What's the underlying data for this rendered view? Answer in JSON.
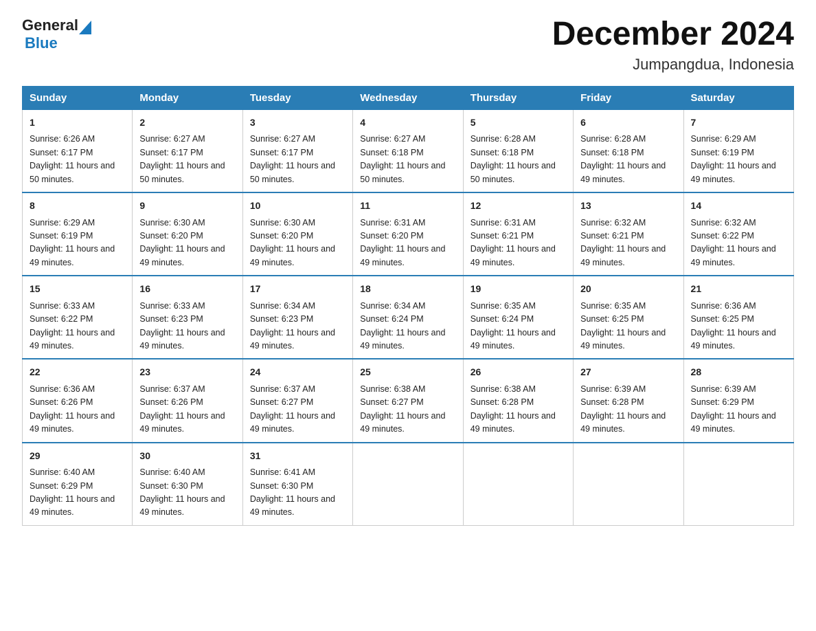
{
  "header": {
    "logo_general": "General",
    "logo_blue": "Blue",
    "title": "December 2024",
    "subtitle": "Jumpangdua, Indonesia"
  },
  "days_of_week": [
    "Sunday",
    "Monday",
    "Tuesday",
    "Wednesday",
    "Thursday",
    "Friday",
    "Saturday"
  ],
  "weeks": [
    [
      {
        "day": "1",
        "sunrise": "Sunrise: 6:26 AM",
        "sunset": "Sunset: 6:17 PM",
        "daylight": "Daylight: 11 hours and 50 minutes."
      },
      {
        "day": "2",
        "sunrise": "Sunrise: 6:27 AM",
        "sunset": "Sunset: 6:17 PM",
        "daylight": "Daylight: 11 hours and 50 minutes."
      },
      {
        "day": "3",
        "sunrise": "Sunrise: 6:27 AM",
        "sunset": "Sunset: 6:17 PM",
        "daylight": "Daylight: 11 hours and 50 minutes."
      },
      {
        "day": "4",
        "sunrise": "Sunrise: 6:27 AM",
        "sunset": "Sunset: 6:18 PM",
        "daylight": "Daylight: 11 hours and 50 minutes."
      },
      {
        "day": "5",
        "sunrise": "Sunrise: 6:28 AM",
        "sunset": "Sunset: 6:18 PM",
        "daylight": "Daylight: 11 hours and 50 minutes."
      },
      {
        "day": "6",
        "sunrise": "Sunrise: 6:28 AM",
        "sunset": "Sunset: 6:18 PM",
        "daylight": "Daylight: 11 hours and 49 minutes."
      },
      {
        "day": "7",
        "sunrise": "Sunrise: 6:29 AM",
        "sunset": "Sunset: 6:19 PM",
        "daylight": "Daylight: 11 hours and 49 minutes."
      }
    ],
    [
      {
        "day": "8",
        "sunrise": "Sunrise: 6:29 AM",
        "sunset": "Sunset: 6:19 PM",
        "daylight": "Daylight: 11 hours and 49 minutes."
      },
      {
        "day": "9",
        "sunrise": "Sunrise: 6:30 AM",
        "sunset": "Sunset: 6:20 PM",
        "daylight": "Daylight: 11 hours and 49 minutes."
      },
      {
        "day": "10",
        "sunrise": "Sunrise: 6:30 AM",
        "sunset": "Sunset: 6:20 PM",
        "daylight": "Daylight: 11 hours and 49 minutes."
      },
      {
        "day": "11",
        "sunrise": "Sunrise: 6:31 AM",
        "sunset": "Sunset: 6:20 PM",
        "daylight": "Daylight: 11 hours and 49 minutes."
      },
      {
        "day": "12",
        "sunrise": "Sunrise: 6:31 AM",
        "sunset": "Sunset: 6:21 PM",
        "daylight": "Daylight: 11 hours and 49 minutes."
      },
      {
        "day": "13",
        "sunrise": "Sunrise: 6:32 AM",
        "sunset": "Sunset: 6:21 PM",
        "daylight": "Daylight: 11 hours and 49 minutes."
      },
      {
        "day": "14",
        "sunrise": "Sunrise: 6:32 AM",
        "sunset": "Sunset: 6:22 PM",
        "daylight": "Daylight: 11 hours and 49 minutes."
      }
    ],
    [
      {
        "day": "15",
        "sunrise": "Sunrise: 6:33 AM",
        "sunset": "Sunset: 6:22 PM",
        "daylight": "Daylight: 11 hours and 49 minutes."
      },
      {
        "day": "16",
        "sunrise": "Sunrise: 6:33 AM",
        "sunset": "Sunset: 6:23 PM",
        "daylight": "Daylight: 11 hours and 49 minutes."
      },
      {
        "day": "17",
        "sunrise": "Sunrise: 6:34 AM",
        "sunset": "Sunset: 6:23 PM",
        "daylight": "Daylight: 11 hours and 49 minutes."
      },
      {
        "day": "18",
        "sunrise": "Sunrise: 6:34 AM",
        "sunset": "Sunset: 6:24 PM",
        "daylight": "Daylight: 11 hours and 49 minutes."
      },
      {
        "day": "19",
        "sunrise": "Sunrise: 6:35 AM",
        "sunset": "Sunset: 6:24 PM",
        "daylight": "Daylight: 11 hours and 49 minutes."
      },
      {
        "day": "20",
        "sunrise": "Sunrise: 6:35 AM",
        "sunset": "Sunset: 6:25 PM",
        "daylight": "Daylight: 11 hours and 49 minutes."
      },
      {
        "day": "21",
        "sunrise": "Sunrise: 6:36 AM",
        "sunset": "Sunset: 6:25 PM",
        "daylight": "Daylight: 11 hours and 49 minutes."
      }
    ],
    [
      {
        "day": "22",
        "sunrise": "Sunrise: 6:36 AM",
        "sunset": "Sunset: 6:26 PM",
        "daylight": "Daylight: 11 hours and 49 minutes."
      },
      {
        "day": "23",
        "sunrise": "Sunrise: 6:37 AM",
        "sunset": "Sunset: 6:26 PM",
        "daylight": "Daylight: 11 hours and 49 minutes."
      },
      {
        "day": "24",
        "sunrise": "Sunrise: 6:37 AM",
        "sunset": "Sunset: 6:27 PM",
        "daylight": "Daylight: 11 hours and 49 minutes."
      },
      {
        "day": "25",
        "sunrise": "Sunrise: 6:38 AM",
        "sunset": "Sunset: 6:27 PM",
        "daylight": "Daylight: 11 hours and 49 minutes."
      },
      {
        "day": "26",
        "sunrise": "Sunrise: 6:38 AM",
        "sunset": "Sunset: 6:28 PM",
        "daylight": "Daylight: 11 hours and 49 minutes."
      },
      {
        "day": "27",
        "sunrise": "Sunrise: 6:39 AM",
        "sunset": "Sunset: 6:28 PM",
        "daylight": "Daylight: 11 hours and 49 minutes."
      },
      {
        "day": "28",
        "sunrise": "Sunrise: 6:39 AM",
        "sunset": "Sunset: 6:29 PM",
        "daylight": "Daylight: 11 hours and 49 minutes."
      }
    ],
    [
      {
        "day": "29",
        "sunrise": "Sunrise: 6:40 AM",
        "sunset": "Sunset: 6:29 PM",
        "daylight": "Daylight: 11 hours and 49 minutes."
      },
      {
        "day": "30",
        "sunrise": "Sunrise: 6:40 AM",
        "sunset": "Sunset: 6:30 PM",
        "daylight": "Daylight: 11 hours and 49 minutes."
      },
      {
        "day": "31",
        "sunrise": "Sunrise: 6:41 AM",
        "sunset": "Sunset: 6:30 PM",
        "daylight": "Daylight: 11 hours and 49 minutes."
      },
      null,
      null,
      null,
      null
    ]
  ]
}
